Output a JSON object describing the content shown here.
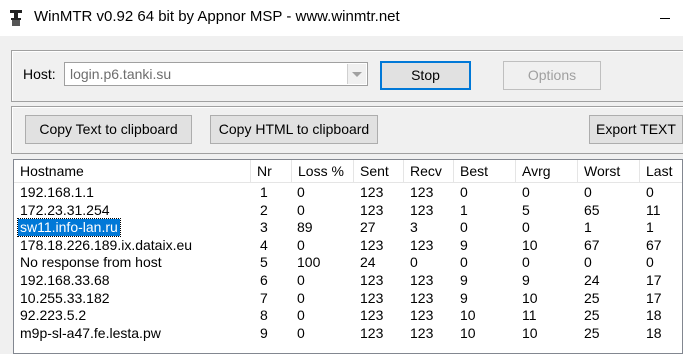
{
  "window": {
    "title": "WinMTR v0.92 64 bit by Appnor MSP - www.winmtr.net",
    "icon": "winmtr-app-icon"
  },
  "host": {
    "label": "Host:",
    "value": "login.p6.tanki.su"
  },
  "buttons": {
    "stop": "Stop",
    "options": "Options",
    "copy_text": "Copy Text to clipboard",
    "copy_html": "Copy HTML to clipboard",
    "export_text": "Export TEXT"
  },
  "table": {
    "columns": [
      "Hostname",
      "Nr",
      "Loss %",
      "Sent",
      "Recv",
      "Best",
      "Avrg",
      "Worst",
      "Last"
    ],
    "rows": [
      [
        "192.168.1.1",
        "1",
        "0",
        "123",
        "123",
        "0",
        "0",
        "0",
        "0"
      ],
      [
        "172.23.31.254",
        "2",
        "0",
        "123",
        "123",
        "1",
        "5",
        "65",
        "11"
      ],
      [
        "sw11.info-lan.ru",
        "3",
        "89",
        "27",
        "3",
        "0",
        "0",
        "1",
        "1"
      ],
      [
        "178.18.226.189.ix.dataix.eu",
        "4",
        "0",
        "123",
        "123",
        "9",
        "10",
        "67",
        "67"
      ],
      [
        "No response from host",
        "5",
        "100",
        "24",
        "0",
        "0",
        "0",
        "0",
        "0"
      ],
      [
        "192.168.33.68",
        "6",
        "0",
        "123",
        "123",
        "9",
        "9",
        "24",
        "17"
      ],
      [
        "10.255.33.182",
        "7",
        "0",
        "123",
        "123",
        "9",
        "10",
        "25",
        "17"
      ],
      [
        "92.223.5.2",
        "8",
        "0",
        "123",
        "123",
        "10",
        "11",
        "25",
        "18"
      ],
      [
        "m9p-sl-a47.fe.lesta.pw",
        "9",
        "0",
        "123",
        "123",
        "10",
        "10",
        "25",
        "18"
      ]
    ],
    "selected_row": 2
  },
  "colors": {
    "selection": "#0078d7",
    "default_button_border": "#0078d7"
  }
}
